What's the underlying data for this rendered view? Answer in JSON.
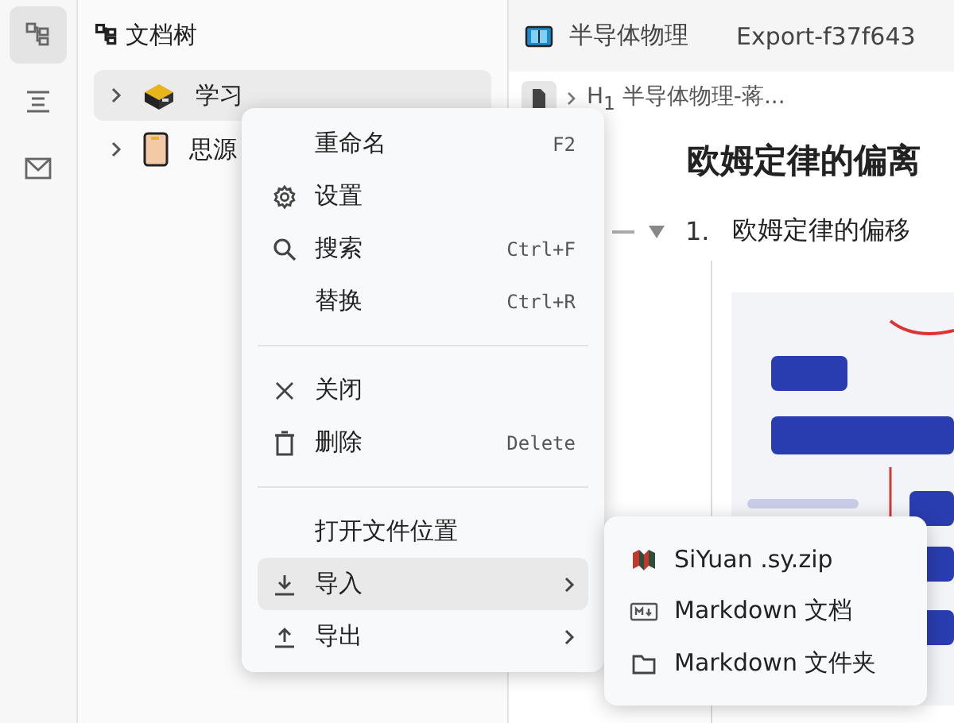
{
  "activity_bar": [
    {
      "kind": "tree",
      "selected": true
    },
    {
      "kind": "outline",
      "selected": false
    },
    {
      "kind": "inbox",
      "selected": false
    }
  ],
  "sidebar": {
    "title": "文档树",
    "items": [
      {
        "label": "学习",
        "kind": "box",
        "selected": true
      },
      {
        "label": "思源",
        "kind": "book",
        "selected": false
      }
    ]
  },
  "tabs": [
    {
      "label": "半导体物理",
      "kind": "notebook"
    },
    {
      "label": "Export-f37f643",
      "kind": "plain"
    }
  ],
  "breadcrumb": {
    "heading_tag": "H$_{1}$",
    "label": "半导体物理-蒋..."
  },
  "document": {
    "title": "欧姆定律的偏离",
    "list_item": {
      "number": "1.",
      "text": "欧姆定律的偏移",
      "expanded": true
    }
  },
  "context_menu": {
    "items": [
      {
        "kind": "item",
        "label": "重命名",
        "shortcut": "F2"
      },
      {
        "kind": "gear",
        "label": "设置"
      },
      {
        "kind": "search",
        "label": "搜索",
        "shortcut": "Ctrl+F"
      },
      {
        "kind": "item",
        "label": "替换",
        "shortcut": "Ctrl+R"
      },
      {
        "kind": "separator"
      },
      {
        "kind": "close",
        "label": "关闭"
      },
      {
        "kind": "trash",
        "label": "删除",
        "shortcut": "Delete"
      },
      {
        "kind": "separator"
      },
      {
        "kind": "item",
        "label": "打开文件位置"
      },
      {
        "kind": "import",
        "label": "导入",
        "submenu": true,
        "selected": true
      },
      {
        "kind": "export",
        "label": "导出",
        "submenu": true,
        "selected": false
      }
    ]
  },
  "submenu": {
    "items": [
      {
        "label": "SiYuan .sy.zip",
        "kind": "siyuan"
      },
      {
        "label": "Markdown 文档",
        "kind": "markdown"
      },
      {
        "label": "Markdown 文件夹",
        "kind": "folder"
      }
    ]
  }
}
